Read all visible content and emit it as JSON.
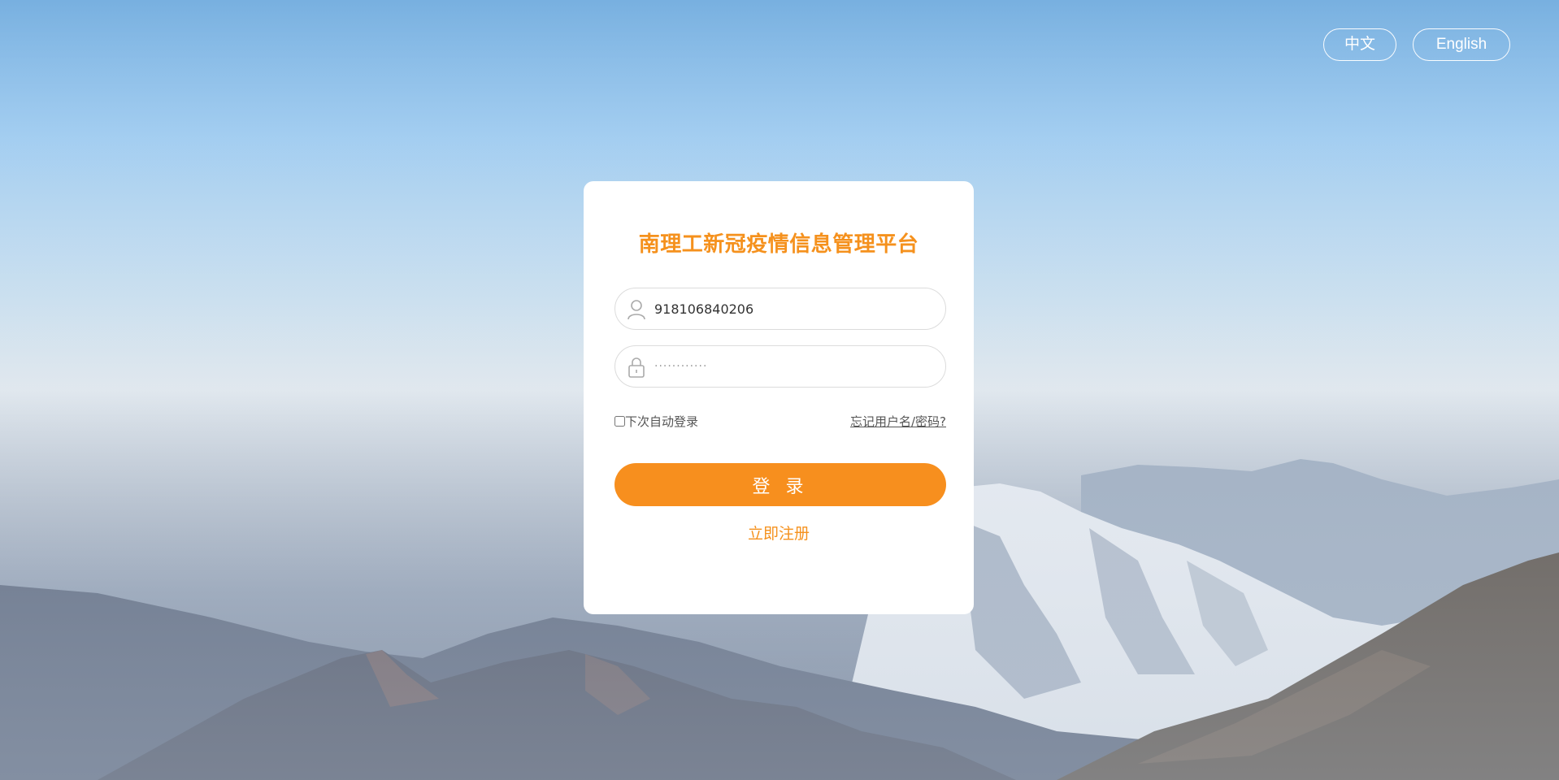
{
  "language_switch": {
    "zh_label": "中文",
    "en_label": "English"
  },
  "login": {
    "title": "南理工新冠疫情信息管理平台",
    "username_value": "918106840206",
    "password_value": "············",
    "remember_label": "下次自动登录",
    "forgot_label": "忘记用户名/密码?",
    "submit_label": "登 录",
    "register_label": "立即注册"
  },
  "colors": {
    "accent": "#f78f1e",
    "card": "#ffffff",
    "field_border": "#dcdcdc"
  },
  "icons": {
    "username": "user-icon",
    "password": "lock-icon"
  }
}
